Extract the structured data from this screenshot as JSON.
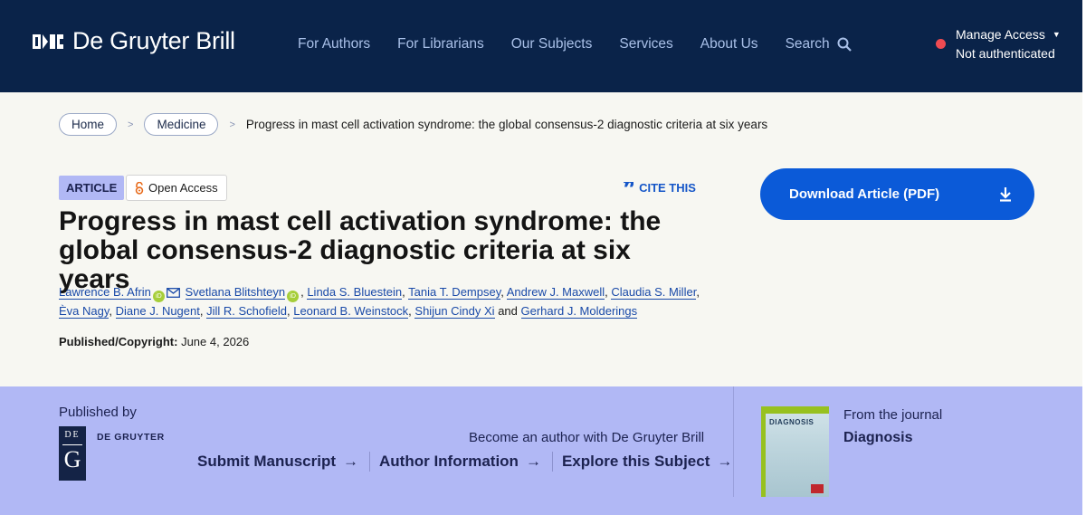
{
  "header": {
    "logo_text": "De Gruyter Brill",
    "nav": [
      "For Authors",
      "For Librarians",
      "Our Subjects",
      "Services",
      "About Us"
    ],
    "search_label": "Search",
    "access_label": "Manage Access",
    "auth_status": "Not authenticated"
  },
  "breadcrumb": {
    "home": "Home",
    "section": "Medicine",
    "current": "Progress in mast cell activation syndrome: the global consensus-2 diagnostic criteria at six years"
  },
  "article": {
    "type_badge": "ARTICLE",
    "access_badge": "Open Access",
    "cite_label": "CITE THIS",
    "title": "Progress in mast cell activation syndrome: the global consensus-2 diagnostic criteria at six years",
    "authors": [
      "Lawrence B. Afrin",
      "Svetlana Blitshteyn",
      "Linda S. Bluestein",
      "Tania T. Dempsey",
      "Andrew J. Maxwell",
      "Claudia S. Miller",
      "Èva Nagy",
      "Diane J. Nugent",
      "Jill R. Schofield",
      "Leonard B. Weinstock",
      "Shijun Cindy Xi",
      "Gerhard J. Molderings"
    ],
    "and_word": "and",
    "published_label": "Published/Copyright:",
    "published_date": "June 4, 2026",
    "download_label": "Download Article (PDF)"
  },
  "footer_band": {
    "published_by": "Published by",
    "publisher_logo_top": "DE",
    "publisher_logo_letter": "G",
    "publisher_name": "DE GRUYTER",
    "become_author": "Become an author with De Gruyter Brill",
    "links": [
      "Submit Manuscript",
      "Author Information",
      "Explore this Subject"
    ],
    "from_journal": "From the journal",
    "journal_name": "Diagnosis",
    "cover_title": "DIAGNOSIS"
  },
  "colors": {
    "header_bg": "#0a2349",
    "band_bg": "#b1b8f5",
    "accent_blue": "#0b5ad8",
    "page_bg": "#f7f7f2",
    "status_dot": "#ef4b52"
  }
}
